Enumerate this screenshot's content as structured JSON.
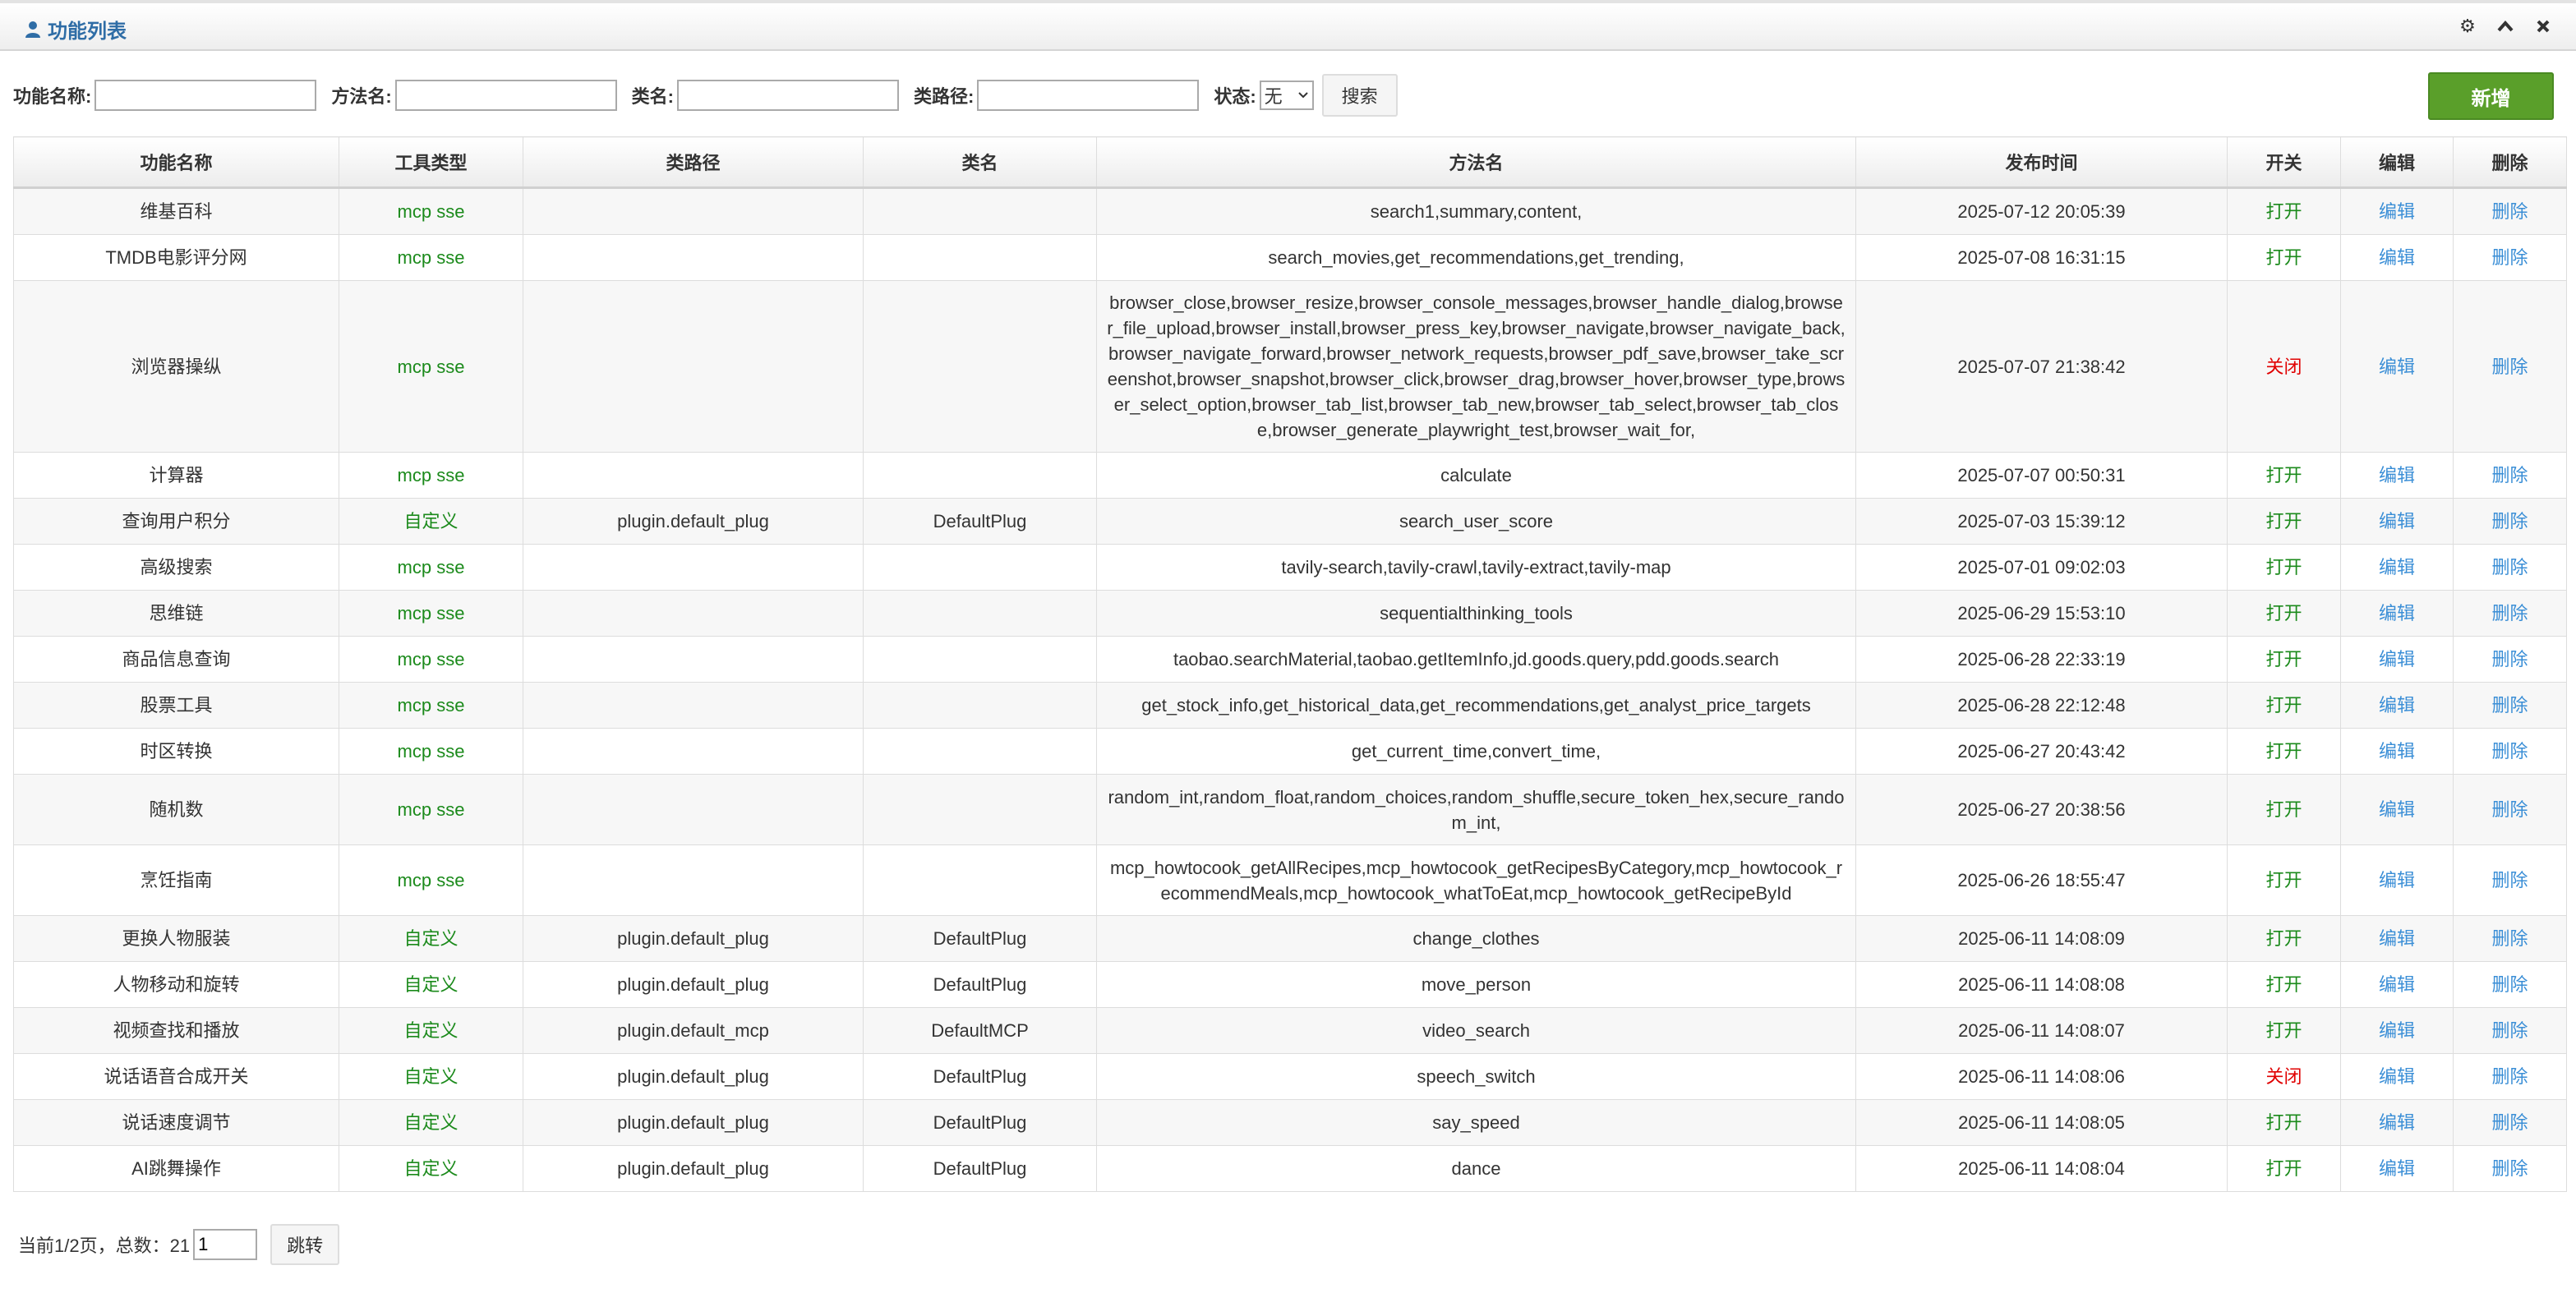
{
  "header": {
    "title": "功能列表"
  },
  "search": {
    "name_label": "功能名称:",
    "method_label": "方法名:",
    "class_label": "类名:",
    "path_label": "类路径:",
    "status_label": "状态:",
    "status_value": "无",
    "search_button": "搜索",
    "add_button": "新增"
  },
  "table": {
    "headers": [
      "功能名称",
      "工具类型",
      "类路径",
      "类名",
      "方法名",
      "发布时间",
      "开关",
      "编辑",
      "删除"
    ],
    "rows": [
      {
        "name": "维基百科",
        "tool": "mcp sse",
        "path": "",
        "cls": "",
        "method": "search1,summary,content,",
        "time": "2025-07-12 20:05:39",
        "switch": "打开",
        "edit": "编辑",
        "del": "删除"
      },
      {
        "name": "TMDB电影评分网",
        "tool": "mcp sse",
        "path": "",
        "cls": "",
        "method": "search_movies,get_recommendations,get_trending,",
        "time": "2025-07-08 16:31:15",
        "switch": "打开",
        "edit": "编辑",
        "del": "删除"
      },
      {
        "name": "浏览器操纵",
        "tool": "mcp sse",
        "path": "",
        "cls": "",
        "method": "browser_close,browser_resize,browser_console_messages,browser_handle_dialog,browser_file_upload,browser_install,browser_press_key,browser_navigate,browser_navigate_back,browser_navigate_forward,browser_network_requests,browser_pdf_save,browser_take_screenshot,browser_snapshot,browser_click,browser_drag,browser_hover,browser_type,browser_select_option,browser_tab_list,browser_tab_new,browser_tab_select,browser_tab_close,browser_generate_playwright_test,browser_wait_for,",
        "time": "2025-07-07 21:38:42",
        "switch": "关闭",
        "edit": "编辑",
        "del": "删除"
      },
      {
        "name": "计算器",
        "tool": "mcp sse",
        "path": "",
        "cls": "",
        "method": "calculate",
        "time": "2025-07-07 00:50:31",
        "switch": "打开",
        "edit": "编辑",
        "del": "删除"
      },
      {
        "name": "查询用户积分",
        "tool": "自定义",
        "path": "plugin.default_plug",
        "cls": "DefaultPlug",
        "method": "search_user_score",
        "time": "2025-07-03 15:39:12",
        "switch": "打开",
        "edit": "编辑",
        "del": "删除"
      },
      {
        "name": "高级搜索",
        "tool": "mcp sse",
        "path": "",
        "cls": "",
        "method": "tavily-search,tavily-crawl,tavily-extract,tavily-map",
        "time": "2025-07-01 09:02:03",
        "switch": "打开",
        "edit": "编辑",
        "del": "删除"
      },
      {
        "name": "思维链",
        "tool": "mcp sse",
        "path": "",
        "cls": "",
        "method": "sequentialthinking_tools",
        "time": "2025-06-29 15:53:10",
        "switch": "打开",
        "edit": "编辑",
        "del": "删除"
      },
      {
        "name": "商品信息查询",
        "tool": "mcp sse",
        "path": "",
        "cls": "",
        "method": "taobao.searchMaterial,taobao.getItemInfo,jd.goods.query,pdd.goods.search",
        "time": "2025-06-28 22:33:19",
        "switch": "打开",
        "edit": "编辑",
        "del": "删除"
      },
      {
        "name": "股票工具",
        "tool": "mcp sse",
        "path": "",
        "cls": "",
        "method": "get_stock_info,get_historical_data,get_recommendations,get_analyst_price_targets",
        "time": "2025-06-28 22:12:48",
        "switch": "打开",
        "edit": "编辑",
        "del": "删除"
      },
      {
        "name": "时区转换",
        "tool": "mcp sse",
        "path": "",
        "cls": "",
        "method": "get_current_time,convert_time,",
        "time": "2025-06-27 20:43:42",
        "switch": "打开",
        "edit": "编辑",
        "del": "删除"
      },
      {
        "name": "随机数",
        "tool": "mcp sse",
        "path": "",
        "cls": "",
        "method": "random_int,random_float,random_choices,random_shuffle,secure_token_hex,secure_random_int,",
        "time": "2025-06-27 20:38:56",
        "switch": "打开",
        "edit": "编辑",
        "del": "删除"
      },
      {
        "name": "烹饪指南",
        "tool": "mcp sse",
        "path": "",
        "cls": "",
        "method": "mcp_howtocook_getAllRecipes,mcp_howtocook_getRecipesByCategory,mcp_howtocook_recommendMeals,mcp_howtocook_whatToEat,mcp_howtocook_getRecipeById",
        "time": "2025-06-26 18:55:47",
        "switch": "打开",
        "edit": "编辑",
        "del": "删除"
      },
      {
        "name": "更换人物服装",
        "tool": "自定义",
        "path": "plugin.default_plug",
        "cls": "DefaultPlug",
        "method": "change_clothes",
        "time": "2025-06-11 14:08:09",
        "switch": "打开",
        "edit": "编辑",
        "del": "删除"
      },
      {
        "name": "人物移动和旋转",
        "tool": "自定义",
        "path": "plugin.default_plug",
        "cls": "DefaultPlug",
        "method": "move_person",
        "time": "2025-06-11 14:08:08",
        "switch": "打开",
        "edit": "编辑",
        "del": "删除"
      },
      {
        "name": "视频查找和播放",
        "tool": "自定义",
        "path": "plugin.default_mcp",
        "cls": "DefaultMCP",
        "method": "video_search",
        "time": "2025-06-11 14:08:07",
        "switch": "打开",
        "edit": "编辑",
        "del": "删除"
      },
      {
        "name": "说话语音合成开关",
        "tool": "自定义",
        "path": "plugin.default_plug",
        "cls": "DefaultPlug",
        "method": "speech_switch",
        "time": "2025-06-11 14:08:06",
        "switch": "关闭",
        "edit": "编辑",
        "del": "删除"
      },
      {
        "name": "说话速度调节",
        "tool": "自定义",
        "path": "plugin.default_plug",
        "cls": "DefaultPlug",
        "method": "say_speed",
        "time": "2025-06-11 14:08:05",
        "switch": "打开",
        "edit": "编辑",
        "del": "删除"
      },
      {
        "name": "AI跳舞操作",
        "tool": "自定义",
        "path": "plugin.default_plug",
        "cls": "DefaultPlug",
        "method": "dance",
        "time": "2025-06-11 14:08:04",
        "switch": "打开",
        "edit": "编辑",
        "del": "删除"
      }
    ]
  },
  "pager": {
    "info": "当前1/2页，总数：21",
    "page_value": "1",
    "jump_button": "跳转"
  }
}
